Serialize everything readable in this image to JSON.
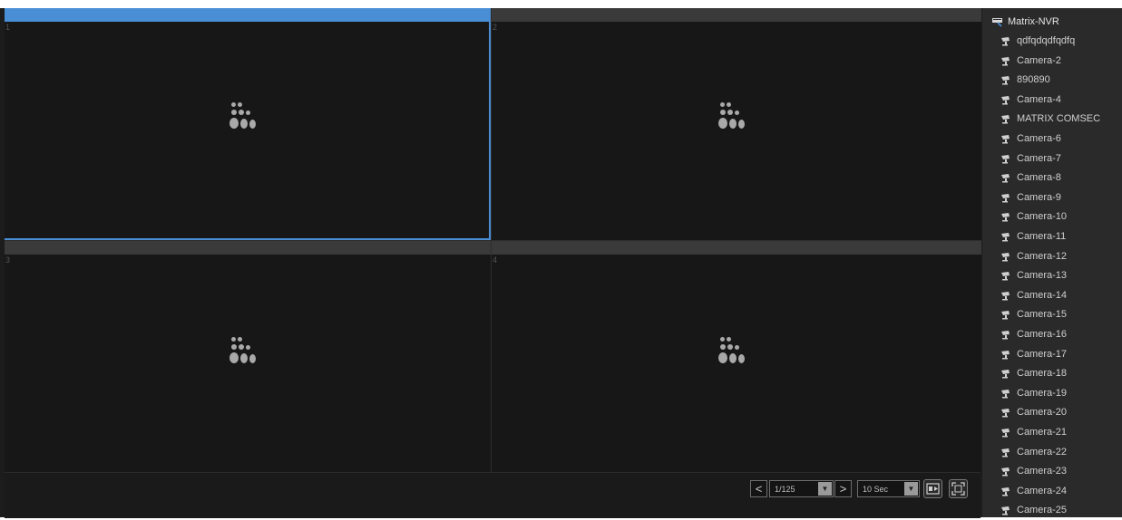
{
  "panes": [
    {
      "number": "1",
      "active": true
    },
    {
      "number": "2",
      "active": false
    },
    {
      "number": "3",
      "active": false
    },
    {
      "number": "4",
      "active": false
    }
  ],
  "pagination": {
    "prev_label": "<",
    "page_value": "1/125",
    "next_label": ">",
    "interval_value": "10 Sec"
  },
  "tree": {
    "root_label": "Matrix-NVR",
    "cameras": [
      "qdfqdqdfqdfq",
      "Camera-2",
      "890890",
      "Camera-4",
      "MATRIX COMSEC",
      "Camera-6",
      "Camera-7",
      "Camera-8",
      "Camera-9",
      "Camera-10",
      "Camera-11",
      "Camera-12",
      "Camera-13",
      "Camera-14",
      "Camera-15",
      "Camera-16",
      "Camera-17",
      "Camera-18",
      "Camera-19",
      "Camera-20",
      "Camera-21",
      "Camera-22",
      "Camera-23",
      "Camera-24",
      "Camera-25"
    ]
  },
  "colors": {
    "active_accent": "#4a8fd6",
    "background": "#171717",
    "panel": "#2a2a2a"
  }
}
